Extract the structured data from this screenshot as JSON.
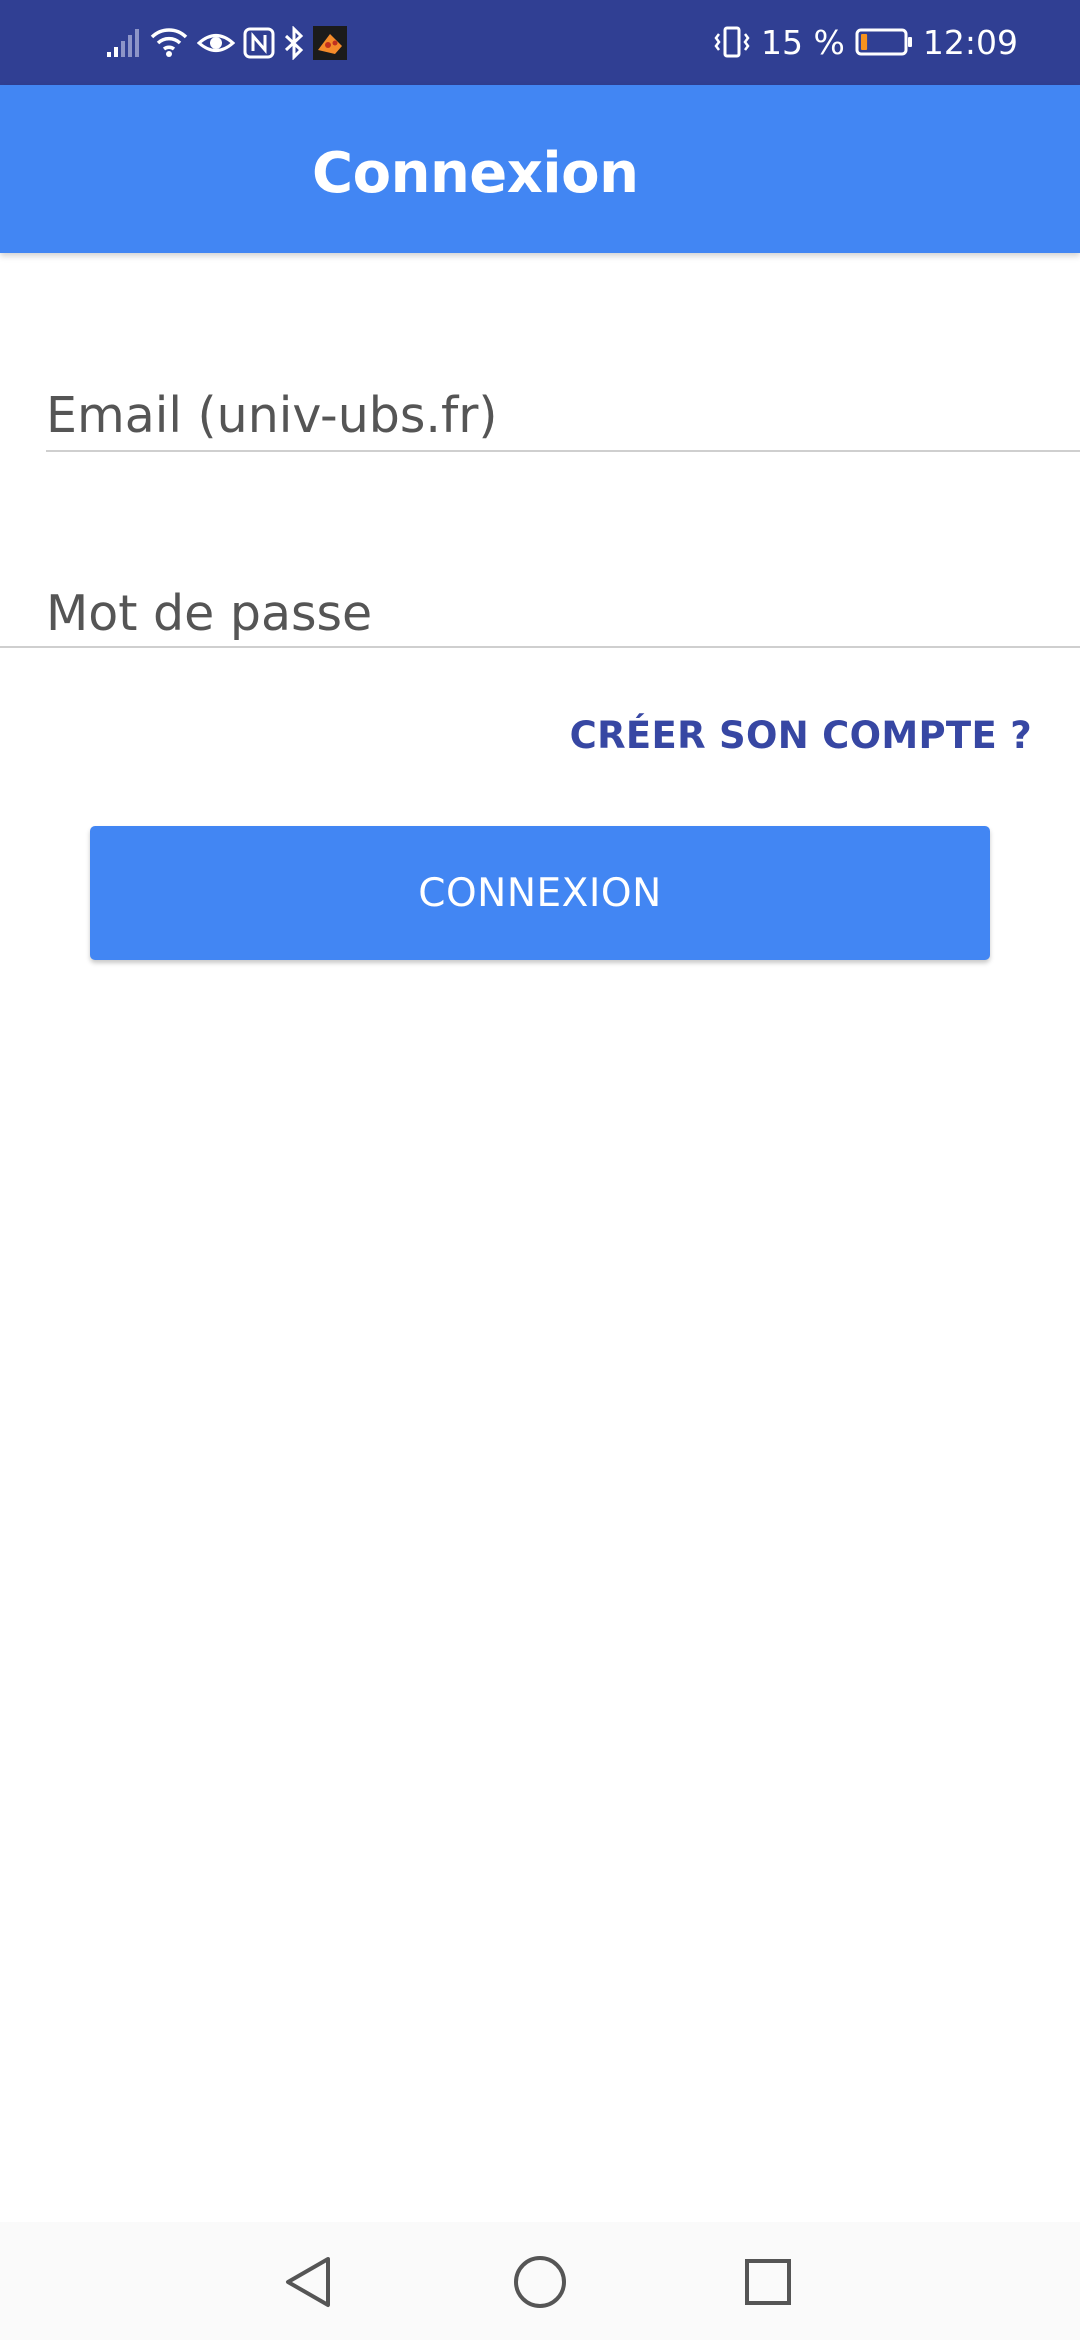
{
  "status_bar": {
    "battery_percent": "15 %",
    "battery_level": 0.15,
    "time": "12:09",
    "icons": [
      "signal-icon",
      "wifi-icon",
      "eye-icon",
      "nfc-icon",
      "bluetooth-icon",
      "app-notification-icon",
      "vibrate-icon",
      "battery-icon"
    ]
  },
  "app_bar": {
    "title": "Connexion"
  },
  "form": {
    "email_placeholder": "Email (univ-ubs.fr)",
    "email_value": "",
    "password_placeholder": "Mot de passe",
    "password_value": "",
    "create_account_label": "CRÉER SON COMPTE ?",
    "login_button_label": "CONNEXION"
  },
  "nav_bar": {
    "icons": [
      "back-icon",
      "home-icon",
      "recents-icon"
    ]
  },
  "colors": {
    "status_bar": "#303f93",
    "primary": "#4286f3",
    "link": "#3747a3",
    "battery_low": "#f7931e"
  }
}
